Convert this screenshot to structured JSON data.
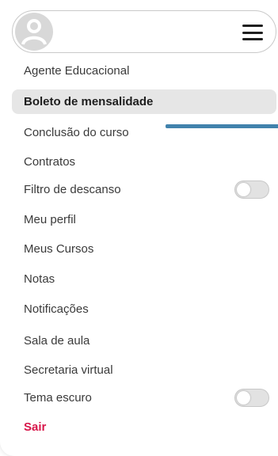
{
  "menu": {
    "items": [
      {
        "label": "Agente Educacional"
      },
      {
        "label": "Boleto de mensalidade",
        "active": true
      },
      {
        "label": "Conclusão do curso"
      },
      {
        "label": "Contratos"
      },
      {
        "label": "Filtro de descanso",
        "toggle": "off"
      },
      {
        "label": "Meu perfil"
      },
      {
        "label": "Meus Cursos"
      },
      {
        "label": "Notas"
      },
      {
        "label": "Notificações"
      },
      {
        "label": "Sala de aula"
      },
      {
        "label": "Secretaria virtual"
      },
      {
        "label": "Tema escuro",
        "toggle": "off"
      },
      {
        "label": "Sair",
        "color": "#d8164a"
      }
    ]
  },
  "icons": {
    "avatar": "user-avatar-icon",
    "menu": "hamburger-menu-icon"
  },
  "colors": {
    "active_bg": "#e6e6e6",
    "logout": "#d8164a",
    "accent_bar": "#4182ac"
  }
}
